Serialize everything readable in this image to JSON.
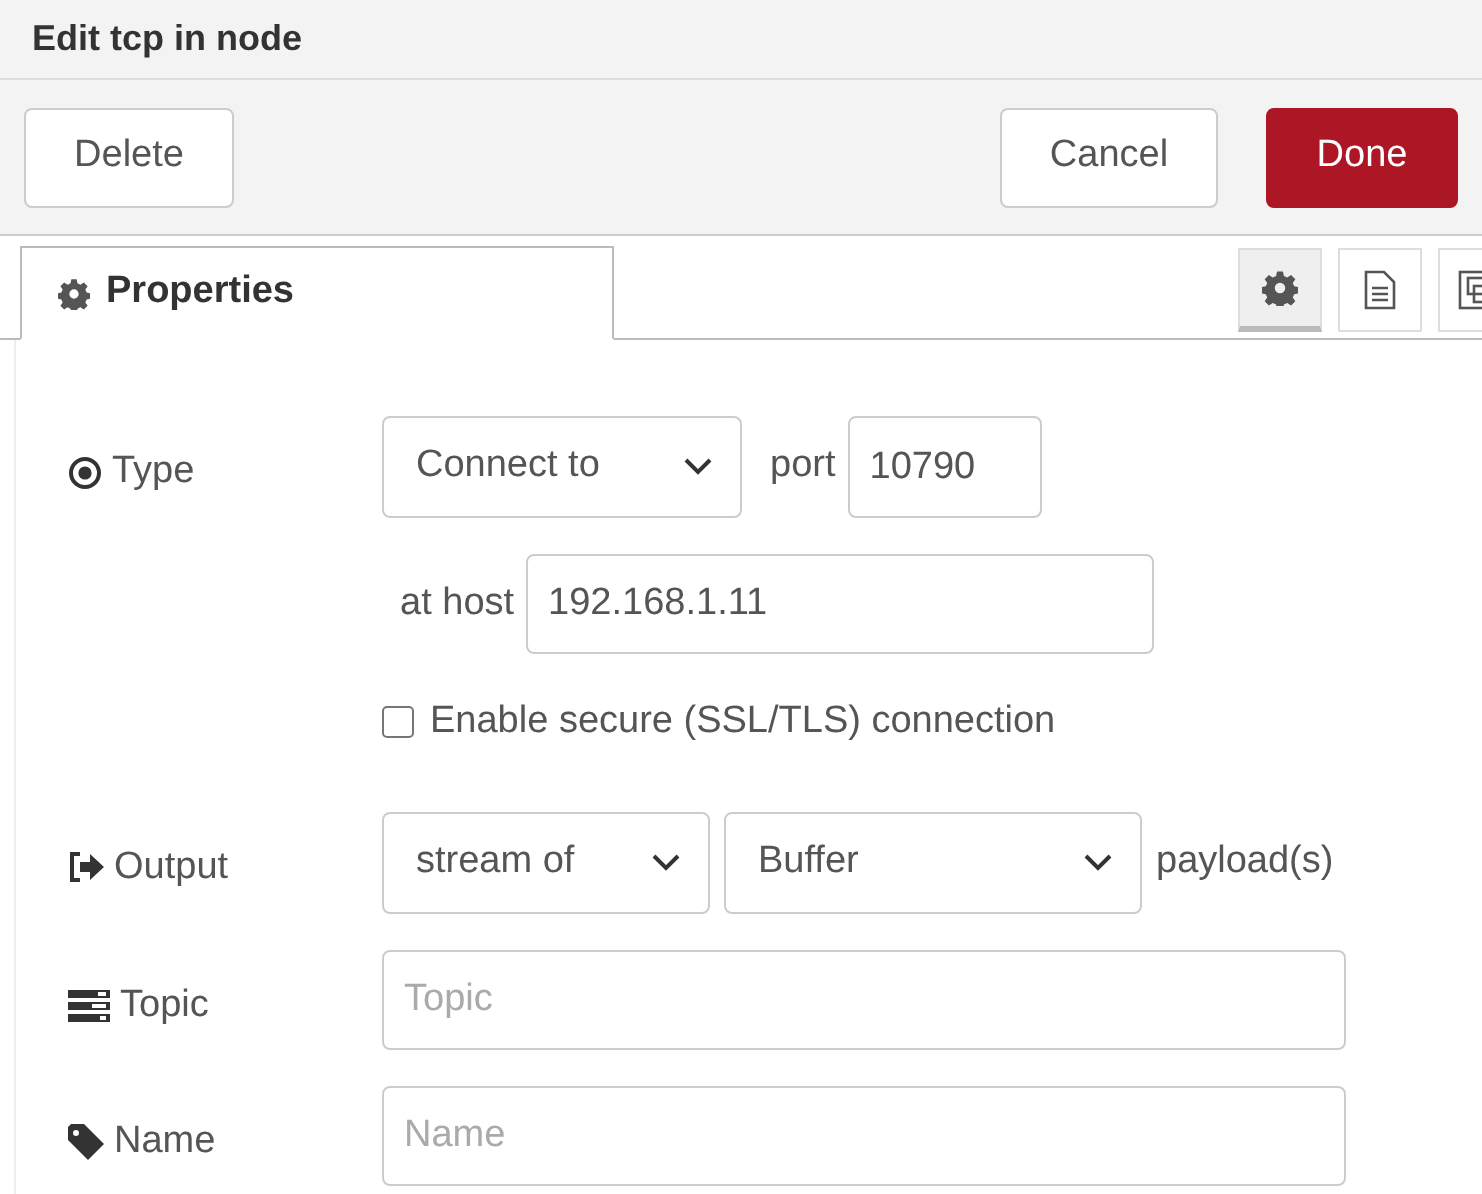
{
  "window": {
    "title": "Edit tcp in node"
  },
  "buttons": [
    {
      "label": "Delete",
      "kind": "plain"
    },
    {
      "label": "Cancel",
      "kind": "plain"
    },
    {
      "label": "Done",
      "kind": "primary"
    }
  ],
  "tabs": [
    {
      "label": "Properties",
      "selected": true
    }
  ],
  "side_tabs": [
    {
      "kind": "gear",
      "selected": true
    },
    {
      "kind": "document",
      "selected": false
    },
    {
      "kind": "frame",
      "selected": false
    }
  ],
  "form": {
    "type": {
      "label": "Type",
      "mode": "Connect to",
      "port_label": "port",
      "port": "10790",
      "host_label": "at host",
      "host": "192.168.1.11",
      "secure_label": "Enable secure (SSL/TLS) connection",
      "secure_checked": false
    },
    "output": {
      "label": "Output",
      "mode": "stream of",
      "format": "Buffer",
      "suffix": "payload(s)"
    },
    "topic": {
      "label": "Topic",
      "placeholder": "Topic"
    },
    "name": {
      "label": "Name",
      "placeholder": "Name"
    }
  }
}
